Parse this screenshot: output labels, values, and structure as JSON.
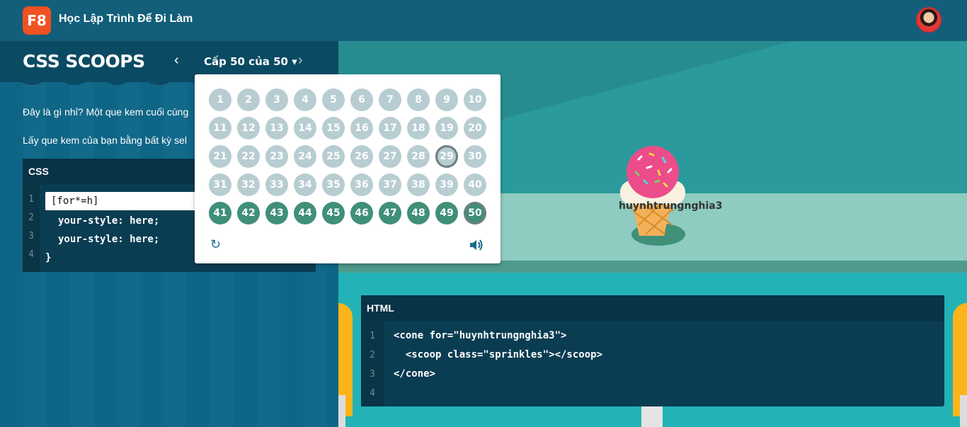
{
  "header": {
    "logo_text": "F8",
    "brand": "Học Lập Trình Để Đi Làm"
  },
  "game": {
    "title": "CSS SCOOPS",
    "prev_icon": "chevron-left-icon",
    "next_icon": "chevron-right-icon",
    "level_label": "Cấp 50 của 50 ▾",
    "instructions": [
      "Đây là gì nhỉ? Một que kem cuối cùng",
      "Lấy que kem của bạn bằng bất kỳ sel"
    ]
  },
  "css_editor": {
    "title": "CSS",
    "line_numbers": [
      "1",
      "2",
      "3",
      "4"
    ],
    "input_value": "[for*=h]",
    "lines": [
      "your-style: here;",
      "your-style: here;",
      "}"
    ]
  },
  "html_editor": {
    "title": "HTML",
    "line_numbers": [
      "1",
      "2",
      "3",
      "4"
    ],
    "lines": [
      "<cone for=\"huynhtrungnghia3\">",
      "  <scoop class=\"sprinkles\"></scoop>",
      "</cone>",
      ""
    ]
  },
  "scene": {
    "cone_label": "huynhtrungnghia3"
  },
  "level_popup": {
    "completed_from": 41,
    "active_levels": [
      29,
      50
    ],
    "levels": [
      "1",
      "2",
      "3",
      "4",
      "5",
      "6",
      "7",
      "8",
      "9",
      "10",
      "11",
      "12",
      "13",
      "14",
      "15",
      "16",
      "17",
      "18",
      "19",
      "20",
      "21",
      "22",
      "23",
      "24",
      "25",
      "26",
      "27",
      "28",
      "29",
      "30",
      "31",
      "32",
      "33",
      "34",
      "35",
      "36",
      "37",
      "38",
      "39",
      "40",
      "41",
      "42",
      "43",
      "44",
      "45",
      "46",
      "47",
      "48",
      "49",
      "50"
    ],
    "reset_icon": "reset-icon",
    "sound_icon": "volume-icon"
  }
}
